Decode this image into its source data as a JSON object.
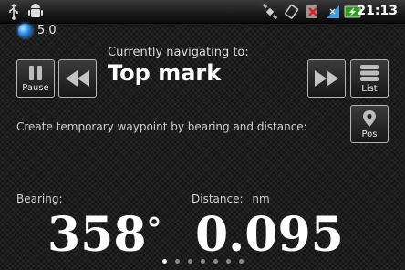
{
  "status_bar": {
    "icons": [
      "usb-icon",
      "android-debug-icon",
      "satellite-icon",
      "rotate-icon",
      "no-sim-icon",
      "signal-icon",
      "battery-charging-icon"
    ],
    "time": "21:13"
  },
  "app": {
    "version": "5.0",
    "icon": "globe-icon"
  },
  "navigation": {
    "caption": "Currently navigating to:",
    "target_name": "Top mark"
  },
  "buttons": {
    "pause_label": "Pause",
    "list_label": "List",
    "pos_label": "Pos"
  },
  "waypoint_hint": "Create temporary waypoint by bearing and distance:",
  "bearing": {
    "label": "Bearing:",
    "value": "358",
    "unit_symbol": "°"
  },
  "distance": {
    "label": "Distance:",
    "unit": "nm",
    "value": "0.095"
  },
  "pager": {
    "page_count": 7,
    "active_index": 0
  },
  "colors": {
    "background": "#1c1c1c",
    "button_border": "#b5b5b5",
    "globe_blue": "#2a8ce8"
  }
}
